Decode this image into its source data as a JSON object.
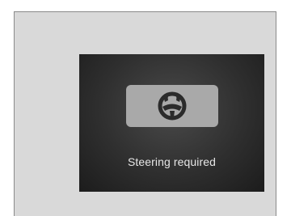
{
  "display": {
    "message": "Steering required",
    "icon": "steering-wheel-hands-icon"
  },
  "colors": {
    "panel_background": "#d9d9d9",
    "screen_background": "#2a2a2a",
    "icon_box": "#a9a9a9",
    "icon_glyph": "#2b2b2b",
    "text": "#e6e6e6"
  }
}
